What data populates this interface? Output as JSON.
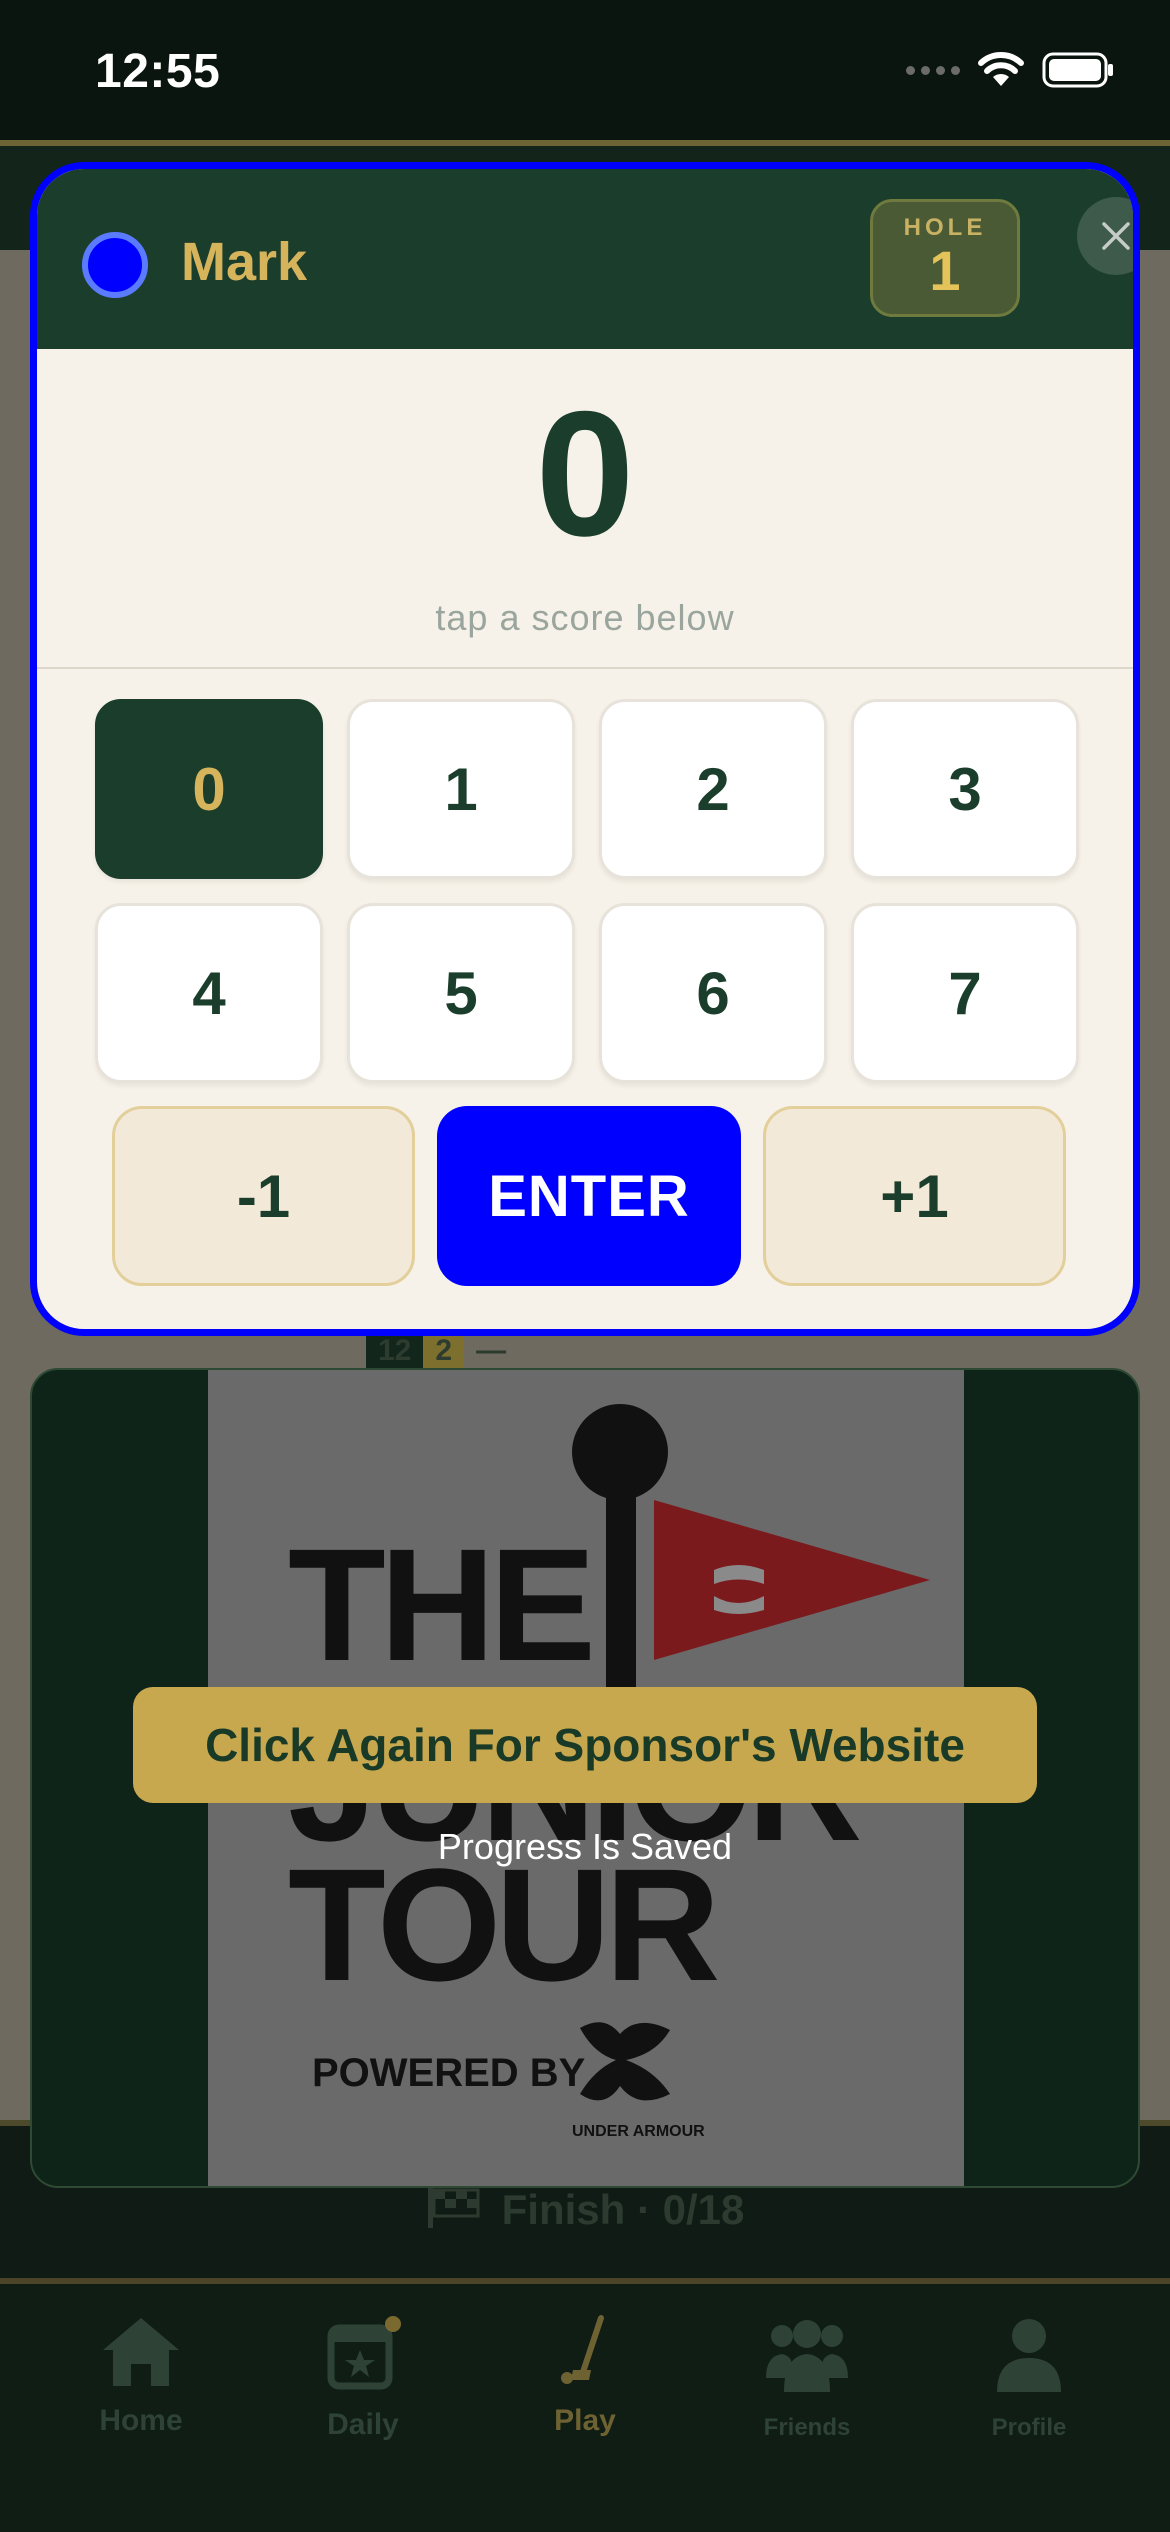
{
  "status_bar": {
    "time": "12:55"
  },
  "modal": {
    "player_name": "Mark",
    "player_color": "#0000ff",
    "hole_label": "HOLE",
    "hole_number": "1",
    "score_value": "0",
    "score_hint": "tap a score below",
    "keys": [
      "0",
      "1",
      "2",
      "3",
      "4",
      "5",
      "6",
      "7"
    ],
    "selected_key": "0",
    "minus_label": "-1",
    "enter_label": "ENTER",
    "plus_label": "+1"
  },
  "sponsor": {
    "button_label": "Click Again For Sponsor's Website",
    "note": "Progress Is Saved",
    "logo_text": [
      "THE",
      "JUNIOR",
      "TOUR"
    ],
    "powered_by": "POWERED BY",
    "brand": "UNDER ARMOUR"
  },
  "background": {
    "score_strip": [
      "12",
      "2",
      "—"
    ],
    "finish_label": "Finish · 0/18"
  },
  "tab_bar": {
    "items": [
      {
        "label": "Home",
        "icon": "home-icon"
      },
      {
        "label": "Daily",
        "icon": "calendar-star-icon"
      },
      {
        "label": "Play",
        "icon": "golf-club-icon"
      },
      {
        "label": "Friends",
        "icon": "friends-icon"
      },
      {
        "label": "Profile",
        "icon": "profile-icon"
      }
    ],
    "active": "Play"
  },
  "colors": {
    "brand_green": "#1b3d2b",
    "gold": "#d6b45c",
    "accent_blue": "#0000ff"
  }
}
